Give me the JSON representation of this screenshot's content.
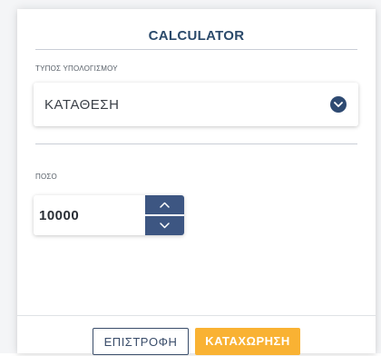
{
  "calculator": {
    "title": "CALCULATOR",
    "calc_type_label": "ΤΥΠΟΣ ΥΠΟΛΟΓΙΣΜΟΥ",
    "calc_type_value": "ΚΑΤΑΘΕΣΗ",
    "amount_label": "ΠΟΣΟ",
    "amount_value": "10000"
  },
  "actions": {
    "back_label": "ΕΠΙΣΤΡΟΦΗ",
    "save_label": "ΚΑΤΑΧΩΡΗΣΗ"
  },
  "icons": {
    "select_toggle": "chevron-down-icon",
    "increment": "chevron-up-icon",
    "decrement": "chevron-down-icon"
  },
  "colors": {
    "title": "#2b4a6b",
    "primary": "#3d5682",
    "accent": "#f9b233"
  }
}
